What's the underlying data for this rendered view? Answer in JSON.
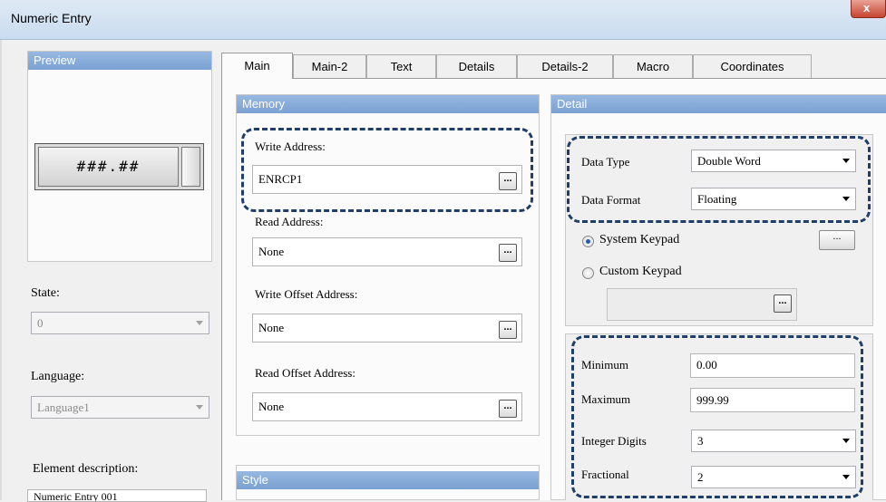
{
  "window": {
    "title": "Numeric Entry",
    "close_glyph": "x"
  },
  "preview": {
    "header": "Preview",
    "display": "###.##"
  },
  "left": {
    "state_label": "State:",
    "state_value": "0",
    "language_label": "Language:",
    "language_value": "Language1",
    "description_label": "Element description:",
    "description_value": "Numeric Entry 001"
  },
  "tabs": [
    "Main",
    "Main-2",
    "Text",
    "Details",
    "Details-2",
    "Macro",
    "Coordinates"
  ],
  "memory": {
    "header": "Memory",
    "write_address_label": "Write Address:",
    "write_address_value": "ENRCP1",
    "read_address_label": "Read Address:",
    "read_address_value": "None",
    "write_offset_label": "Write Offset Address:",
    "write_offset_value": "None",
    "read_offset_label": "Read Offset Address:",
    "read_offset_value": "None",
    "browse_label": "..."
  },
  "style": {
    "header": "Style"
  },
  "detail": {
    "header": "Detail",
    "data_type_label": "Data Type",
    "data_type_value": "Double Word",
    "data_format_label": "Data Format",
    "data_format_value": "Floating",
    "system_keypad_label": "System Keypad",
    "custom_keypad_label": "Custom Keypad",
    "system_keypad_selected": true,
    "keypad_browse_label": "...",
    "minimum_label": "Minimum",
    "minimum_value": "0.00",
    "maximum_label": "Maximum",
    "maximum_value": "999.99",
    "integer_digits_label": "Integer Digits",
    "integer_digits_value": "3",
    "fractional_label": "Fractional",
    "fractional_value": "2"
  },
  "colors": {
    "highlight_dash": "#1f3f6a",
    "panel_header": "#7aa1d3"
  }
}
